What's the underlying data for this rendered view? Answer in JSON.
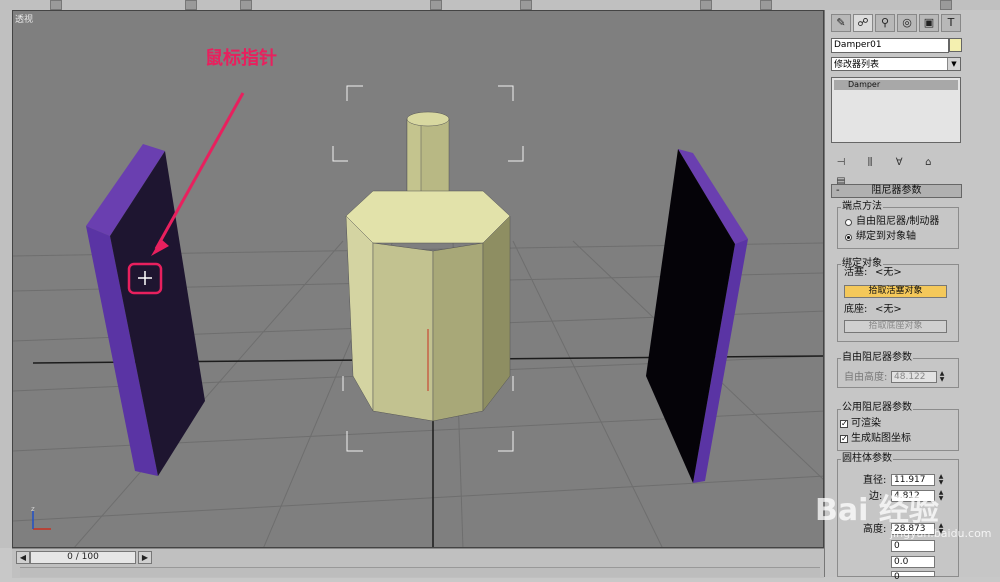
{
  "viewport": {
    "label": "透视"
  },
  "annotation": {
    "text": "鼠标指针"
  },
  "timeline": {
    "frame": "0 / 100"
  },
  "panel": {
    "object_name": "Damper01",
    "modifier_list": "修改器列表",
    "stack_item": "Damper",
    "rollout_title": "阻尼器参数",
    "endpoint_group": "端点方法",
    "radio_free": "自由阻尼器/制动器",
    "radio_bound": "绑定到对象轴",
    "binding_group": "绑定对象",
    "piston_label": "活塞:",
    "piston_value": "<无>",
    "pick_piston": "拾取活塞对象",
    "base_label": "底座:",
    "base_value": "<无>",
    "pick_base": "拾取底座对象",
    "free_group": "自由阻尼器参数",
    "free_height_label": "自由高度:",
    "free_height_value": "48.122",
    "common_group": "公用阻尼器参数",
    "renderable": "可渲染",
    "gen_mapping": "生成贴图坐标",
    "cylinder_group": "圆柱体参数",
    "diameter_label": "直径:",
    "diameter_value": "11.917",
    "sides_label": "边:",
    "sides_value": "4.812",
    "height_label": "高度:",
    "height_value": "28.873",
    "val4": "0",
    "val5": "0.0",
    "val6": "0"
  },
  "watermark": {
    "text": "Bai 经验",
    "sub": "jingyan.baidu.com"
  },
  "colors": {
    "annotation": "#e8205e",
    "viewport_bg": "#7f7f7f",
    "plate": "#5a3a9a",
    "damper": "#d8d8a0"
  }
}
